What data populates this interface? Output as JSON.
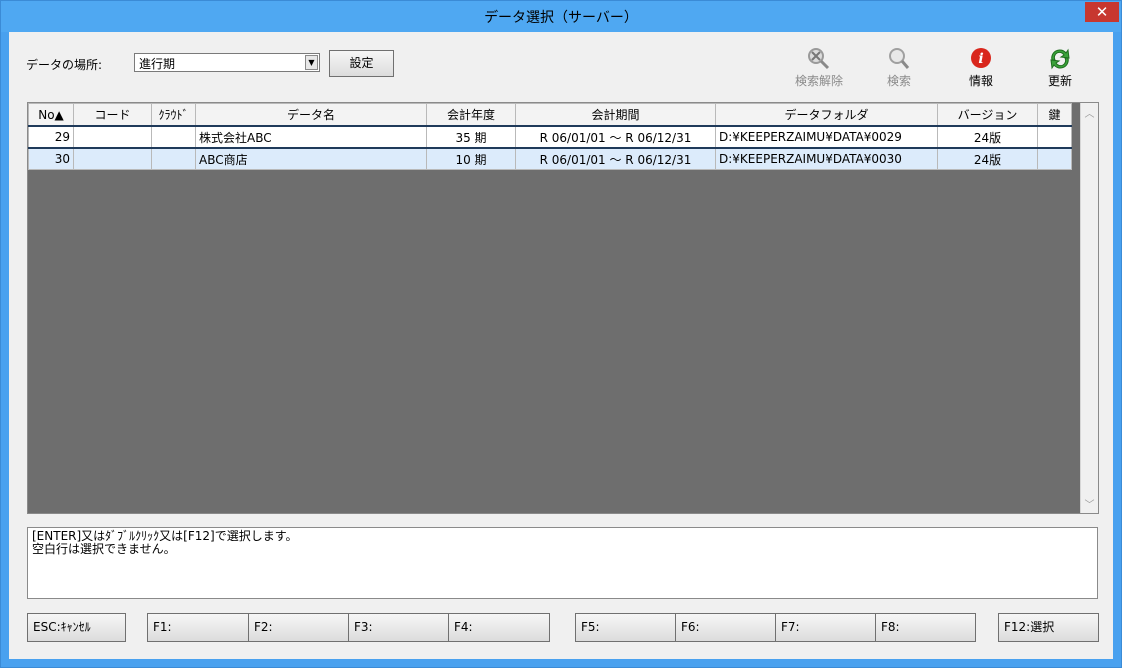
{
  "window": {
    "title": "データ選択（サーバー）",
    "close_glyph": "✕"
  },
  "location": {
    "label": "データの場所:",
    "value": "進行期",
    "set_button": "設定"
  },
  "toolbar": [
    {
      "label": "検索解除",
      "icon": "search-clear-icon",
      "enabled": false
    },
    {
      "label": "検索",
      "icon": "search-icon",
      "enabled": false
    },
    {
      "label": "情報",
      "icon": "info-icon",
      "enabled": true
    },
    {
      "label": "更新",
      "icon": "refresh-icon",
      "enabled": true
    }
  ],
  "grid": {
    "columns": [
      "No▲",
      "コード",
      "ｸﾗｳﾄﾞ",
      "データ名",
      "会計年度",
      "会計期間",
      "データフォルダ",
      "バージョン",
      "鍵"
    ],
    "rows": [
      {
        "no": "29",
        "code": "",
        "cloud": "",
        "name": "株式会社ABC",
        "year": "35 期",
        "period": "R 06/01/01 ～ R 06/12/31",
        "folder": "D:¥KEEPERZAIMU¥DATA¥0029",
        "version": "24版",
        "key": ""
      },
      {
        "no": "30",
        "code": "",
        "cloud": "",
        "name": "ABC商店",
        "year": "10 期",
        "period": "R 06/01/01 ～ R 06/12/31",
        "folder": "D:¥KEEPERZAIMU¥DATA¥0030",
        "version": "24版",
        "key": ""
      }
    ]
  },
  "message": {
    "line1": "[ENTER]又はﾀﾞﾌﾞﾙｸﾘｯｸ又は[F12]で選択します。",
    "line2": "空白行は選択できません。"
  },
  "fkeys": {
    "esc": "ESC:ｷｬﾝｾﾙ",
    "f1": "F1:",
    "f2": "F2:",
    "f3": "F3:",
    "f4": "F4:",
    "f5": "F5:",
    "f6": "F6:",
    "f7": "F7:",
    "f8": "F8:",
    "f12": "F12:選択"
  },
  "colors": {
    "titlebar": "#4fa8f2",
    "close": "#c7372f",
    "grid_bg": "#6e6e6e",
    "row_alt": "#dcebfb"
  }
}
